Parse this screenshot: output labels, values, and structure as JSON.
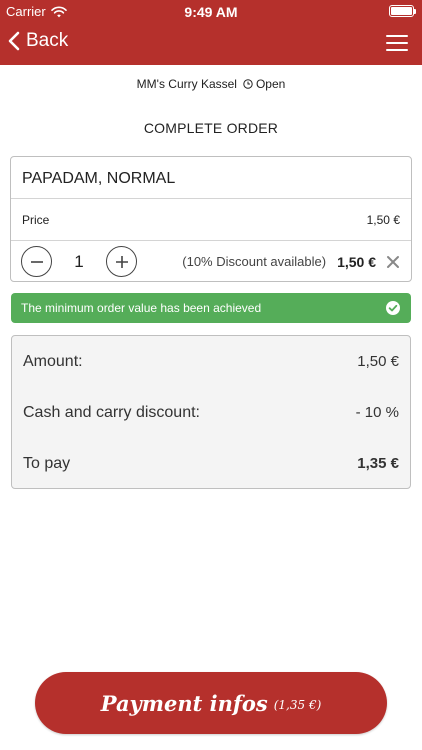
{
  "status_bar": {
    "carrier": "Carrier",
    "time": "9:49 AM"
  },
  "nav": {
    "back_label": "Back",
    "menu_icon": "hamburger-menu-icon"
  },
  "restaurant": {
    "name": "MM's Curry Kassel",
    "status": "Open"
  },
  "page": {
    "title": "COMPLETE ORDER"
  },
  "item": {
    "name": "PAPADAM, NORMAL",
    "price_label": "Price",
    "price_value": "1,50 €",
    "quantity": "1",
    "discount_note": "(10% Discount available)",
    "line_total": "1,50 €"
  },
  "banner": {
    "text": "The minimum order value has been achieved"
  },
  "summary": {
    "rows": [
      {
        "label": "Amount:",
        "value": "1,50 €"
      },
      {
        "label": "Cash and carry discount:",
        "value": "- 10 %"
      },
      {
        "label": "To pay",
        "value": "1,35 €"
      }
    ]
  },
  "payment_button": {
    "label": "Payment infos",
    "amount": "(1,35 €)"
  },
  "colors": {
    "brand": "#b5302c",
    "success": "#55ad59",
    "summary_bg": "#f4f4f4"
  }
}
